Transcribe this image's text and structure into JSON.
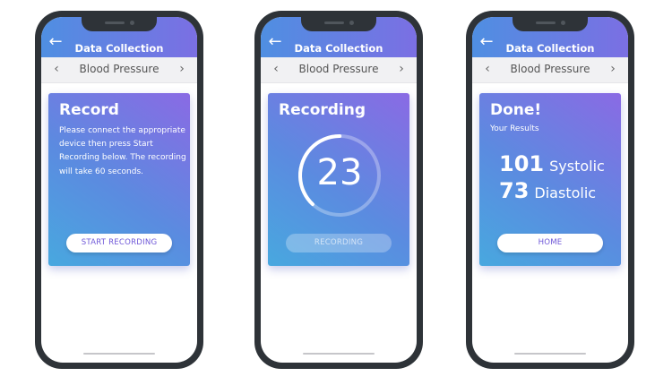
{
  "header": {
    "title": "Data Collection",
    "back_icon": "arrow-left-icon"
  },
  "subnav": {
    "label": "Blood Pressure",
    "prev_icon": "chevron-left-icon",
    "next_icon": "chevron-right-icon"
  },
  "colors": {
    "accent_start": "#4f8fe2",
    "accent_end": "#7b6fe3",
    "button_text": "#6f58d8"
  },
  "screens": [
    {
      "card_title": "Record",
      "card_text": "Please connect the appropriate device then press Start Recording below. The recording will take 60 seconds.",
      "button_label": "START RECORDING"
    },
    {
      "card_title": "Recording",
      "timer_value": "23",
      "timer_progress_fraction": 0.38,
      "button_label": "RECORDING"
    },
    {
      "card_title": "Done!",
      "card_subtitle": "Your Results",
      "results": [
        {
          "value": "101",
          "label": "Systolic"
        },
        {
          "value": "73",
          "label": "Diastolic"
        }
      ],
      "button_label": "HOME"
    }
  ]
}
